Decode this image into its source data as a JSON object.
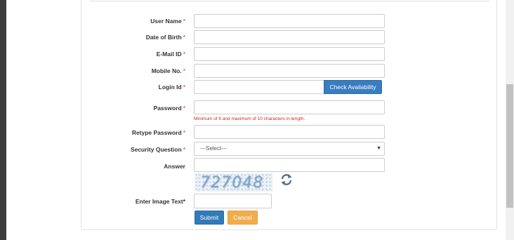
{
  "form": {
    "fields": {
      "user_name": {
        "label": "User Name",
        "required": "*"
      },
      "dob": {
        "label": "Date of Birth",
        "required": "*"
      },
      "email": {
        "label": "E-Mail ID",
        "required": "*"
      },
      "mobile": {
        "label": "Mobile No.",
        "required": "*"
      },
      "login_id": {
        "label": "Login Id",
        "required": "*",
        "button": "Check Availability"
      },
      "password": {
        "label": "Password",
        "required": "*",
        "hint": "Minimum of 6 and maximum of 10 characters in length."
      },
      "retype_password": {
        "label": "Retype Password",
        "required": "*"
      },
      "security_question": {
        "label": "Security Question",
        "required": "*",
        "selected": "---Select---"
      },
      "answer": {
        "label": "Answer"
      },
      "image_text": {
        "label": "Enter Image Text*"
      }
    },
    "captcha_text": "727048",
    "submit_label": "Submit",
    "cancel_label": "Cancel"
  },
  "colors": {
    "primary": "#337ab7",
    "warning": "#f0ad4e",
    "required": "#c9302c"
  },
  "icons": {
    "refresh": "refresh-icon",
    "dropdown": "caret-down-icon"
  }
}
